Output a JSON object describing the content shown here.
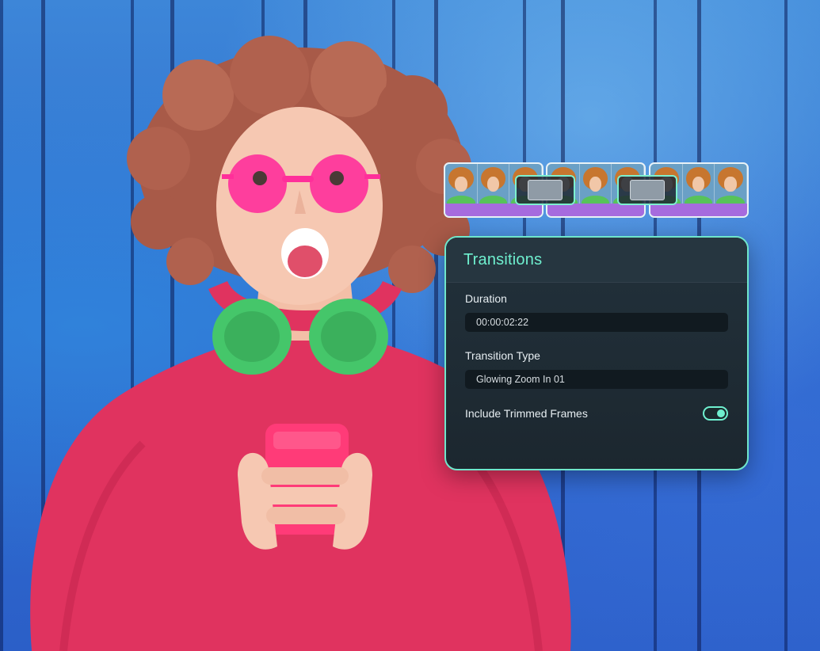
{
  "colors": {
    "accent": "#6ff0cf",
    "panel_background": "#1c272f",
    "field_background": "#111a20",
    "clip_bar": "#a66bde",
    "wall_blue": "#2f6fd0",
    "sweater_pink": "#e0335f",
    "headphones_green": "#45c66a"
  },
  "timeline": {
    "clip_count": 3,
    "transition_count": 2
  },
  "panel": {
    "title": "Transitions",
    "duration": {
      "label": "Duration",
      "value": "00:00:02:22"
    },
    "transition_type": {
      "label": "Transition Type",
      "value": "Glowing Zoom In 01"
    },
    "trimmed_frames": {
      "label": "Include Trimmed Frames",
      "enabled": true,
      "icon": "toggle-switch-icon"
    }
  }
}
